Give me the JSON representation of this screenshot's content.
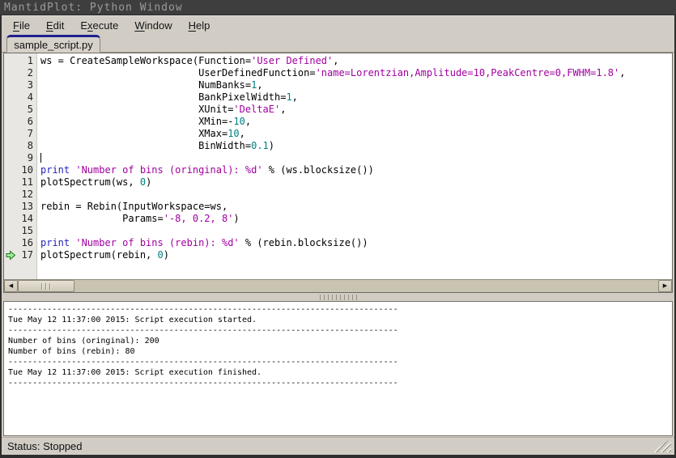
{
  "window": {
    "title": "MantidPlot: Python Window"
  },
  "menu": {
    "items": [
      {
        "label": "File",
        "accel": 0
      },
      {
        "label": "Edit",
        "accel": 0
      },
      {
        "label": "Execute",
        "accel": 1
      },
      {
        "label": "Window",
        "accel": 0
      },
      {
        "label": "Help",
        "accel": 0
      }
    ]
  },
  "tabs": {
    "active": "sample_script.py"
  },
  "colors": {
    "titlebar_bg": "#3e3e3e",
    "chrome_bg": "#d1cdc5",
    "tab_accent": "#1f1f8c",
    "keyword": "#2424be",
    "string": "#a000a0",
    "number": "#007f7f",
    "marker_green_fill": "#9ce89c",
    "marker_green_edge": "#1f7a1f",
    "scrollbar_track": "#c9c3b1"
  },
  "editor": {
    "marker_line": 17,
    "caret_line": 9,
    "lines": [
      {
        "n": 1,
        "tokens": [
          [
            "plain",
            "ws = CreateSampleWorkspace(Function="
          ],
          [
            "str",
            "'User Defined'"
          ],
          [
            "plain",
            ","
          ]
        ]
      },
      {
        "n": 2,
        "tokens": [
          [
            "plain",
            "                           UserDefinedFunction="
          ],
          [
            "str",
            "'name=Lorentzian,Amplitude=10,PeakCentre=0,FWHM=1.8'"
          ],
          [
            "plain",
            ","
          ]
        ]
      },
      {
        "n": 3,
        "tokens": [
          [
            "plain",
            "                           NumBanks="
          ],
          [
            "num",
            "1"
          ],
          [
            "plain",
            ","
          ]
        ]
      },
      {
        "n": 4,
        "tokens": [
          [
            "plain",
            "                           BankPixelWidth="
          ],
          [
            "num",
            "1"
          ],
          [
            "plain",
            ","
          ]
        ]
      },
      {
        "n": 5,
        "tokens": [
          [
            "plain",
            "                           XUnit="
          ],
          [
            "str",
            "'DeltaE'"
          ],
          [
            "plain",
            ","
          ]
        ]
      },
      {
        "n": 6,
        "tokens": [
          [
            "plain",
            "                           XMin=-"
          ],
          [
            "num",
            "10"
          ],
          [
            "plain",
            ","
          ]
        ]
      },
      {
        "n": 7,
        "tokens": [
          [
            "plain",
            "                           XMax="
          ],
          [
            "num",
            "10"
          ],
          [
            "plain",
            ","
          ]
        ]
      },
      {
        "n": 8,
        "tokens": [
          [
            "plain",
            "                           BinWidth="
          ],
          [
            "num",
            "0.1"
          ],
          [
            "plain",
            ")"
          ]
        ]
      },
      {
        "n": 9,
        "tokens": [
          [
            "caret",
            ""
          ]
        ]
      },
      {
        "n": 10,
        "tokens": [
          [
            "kw",
            "print"
          ],
          [
            "plain",
            " "
          ],
          [
            "str",
            "'Number of bins (oringinal): %d'"
          ],
          [
            "plain",
            " % (ws.blocksize())"
          ]
        ]
      },
      {
        "n": 11,
        "tokens": [
          [
            "plain",
            "plotSpectrum(ws, "
          ],
          [
            "num",
            "0"
          ],
          [
            "plain",
            ")"
          ]
        ]
      },
      {
        "n": 12,
        "tokens": []
      },
      {
        "n": 13,
        "tokens": [
          [
            "plain",
            "rebin = Rebin(InputWorkspace=ws,"
          ]
        ]
      },
      {
        "n": 14,
        "tokens": [
          [
            "plain",
            "              Params="
          ],
          [
            "str",
            "'-8, 0.2, 8'"
          ],
          [
            "plain",
            ")"
          ]
        ]
      },
      {
        "n": 15,
        "tokens": []
      },
      {
        "n": 16,
        "tokens": [
          [
            "kw",
            "print"
          ],
          [
            "plain",
            " "
          ],
          [
            "str",
            "'Number of bins (rebin): %d'"
          ],
          [
            "plain",
            " % (rebin.blocksize())"
          ]
        ]
      },
      {
        "n": 17,
        "tokens": [
          [
            "plain",
            "plotSpectrum(rebin, "
          ],
          [
            "num",
            "0"
          ],
          [
            "plain",
            ")"
          ]
        ]
      }
    ]
  },
  "scrollbar": {
    "left_arrow": "◀",
    "right_arrow": "▶"
  },
  "output": {
    "lines": [
      "--------------------------------------------------------------------------------",
      "Tue May 12 11:37:00 2015: Script execution started.",
      "--------------------------------------------------------------------------------",
      "Number of bins (oringinal): 200",
      "Number of bins (rebin): 80",
      "--------------------------------------------------------------------------------",
      "Tue May 12 11:37:00 2015: Script execution finished.",
      "--------------------------------------------------------------------------------"
    ]
  },
  "status": {
    "text": "Status: Stopped"
  }
}
